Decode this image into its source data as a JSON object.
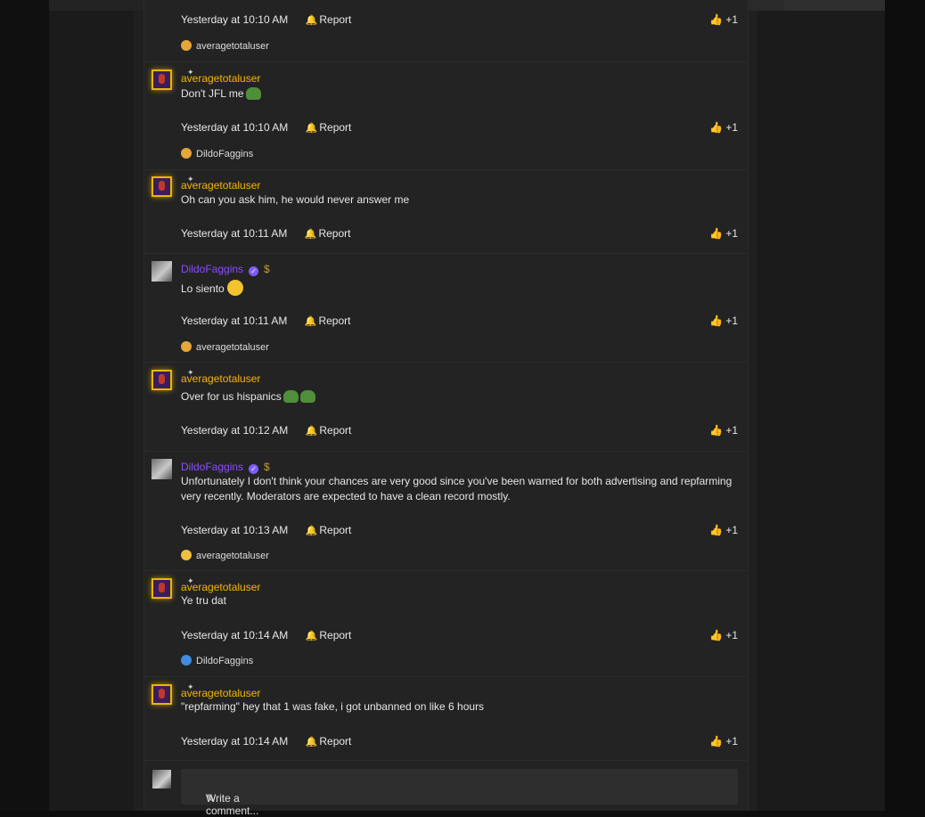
{
  "comments": [
    {
      "id": 0,
      "time": "Yesterday at 10:10 AM",
      "report": "Report",
      "like": "+1",
      "reaction_user": "averagetotaluser",
      "reaction_color": "#e6a63a"
    },
    {
      "id": 1,
      "user": "averagetotaluser",
      "text": "Don't JFL me",
      "time": "Yesterday at 10:10 AM",
      "report": "Report",
      "like": "+1",
      "reaction_user": "DildoFaggins",
      "reaction_color": "#e6a63a"
    },
    {
      "id": 2,
      "user": "averagetotaluser",
      "text": "Oh can you ask him, he would never answer me",
      "time": "Yesterday at 10:11 AM",
      "report": "Report",
      "like": "+1"
    },
    {
      "id": 3,
      "user": "DildoFaggins",
      "dollar": "$",
      "text": "Lo siento",
      "time": "Yesterday at 10:11 AM",
      "report": "Report",
      "like": "+1",
      "reaction_user": "averagetotaluser",
      "reaction_color": "#e6a63a"
    },
    {
      "id": 4,
      "user": "averagetotaluser",
      "text": "Over for us hispanics",
      "time": "Yesterday at 10:12 AM",
      "report": "Report",
      "like": "+1"
    },
    {
      "id": 5,
      "user": "DildoFaggins",
      "dollar": "$",
      "text": "Unfortunately I don't think your chances are very good since you've been warned for both advertising and repfarming very recently. Moderators are expected to have a clean record mostly.",
      "time": "Yesterday at 10:13 AM",
      "report": "Report",
      "like": "+1",
      "reaction_user": "averagetotaluser",
      "reaction_color": "#f0c040"
    },
    {
      "id": 6,
      "user": "averagetotaluser",
      "text": "Ye tru dat",
      "time": "Yesterday at 10:14 AM",
      "report": "Report",
      "like": "+1",
      "reaction_user": "DildoFaggins",
      "reaction_color": "#3f8de0"
    },
    {
      "id": 7,
      "user": "averagetotaluser",
      "text": "\"repfarming\" hey that 1 was fake, i got unbanned on like 6 hours",
      "time": "Yesterday at 10:14 AM",
      "report": "Report",
      "like": "+1"
    }
  ],
  "composer": {
    "placeholder": "Write a comment..."
  },
  "icons": {
    "bell": "bell-icon",
    "thumb": "thumbs-up-icon",
    "pencil": "pencil-icon",
    "verified": "verified-badge-icon",
    "sparkle": "sparkle-icon"
  },
  "colors": {
    "gold_user": "#f5b800",
    "purple_user": "#8a4dff",
    "background": "#232323"
  }
}
